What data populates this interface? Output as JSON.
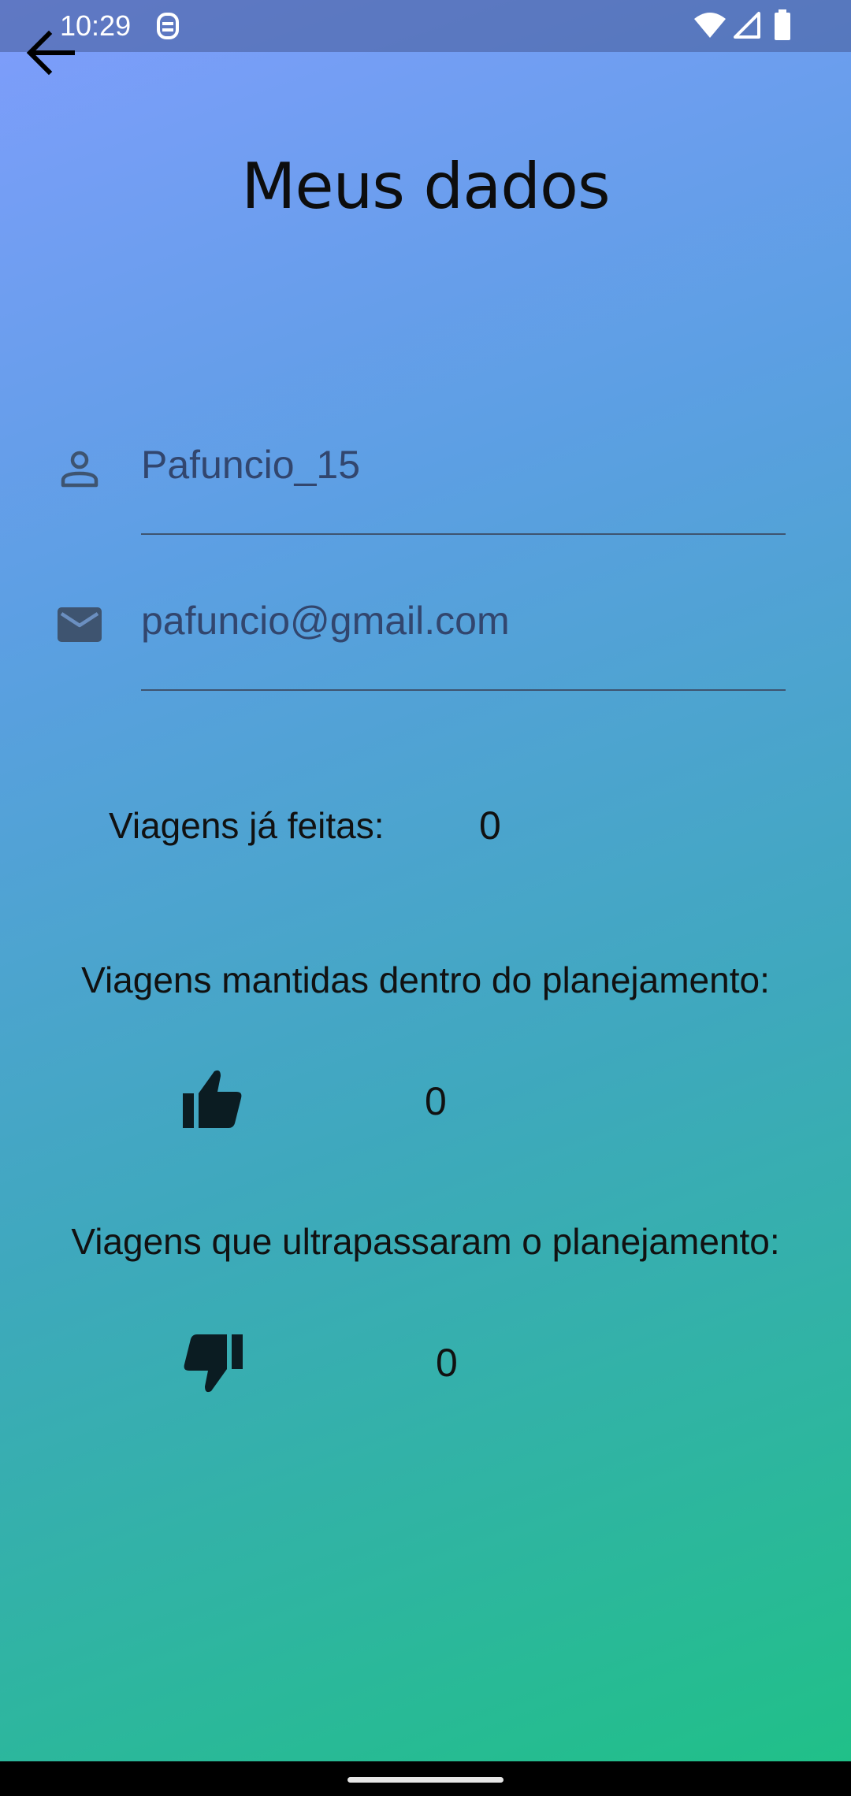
{
  "status_bar": {
    "time": "10:29"
  },
  "header": {
    "title": "Meus dados"
  },
  "profile": {
    "username": "Pafuncio_15",
    "email": "pafuncio@gmail.com"
  },
  "stats": {
    "trips_done_label": "Viagens já feitas:",
    "trips_done_value": "0",
    "within_plan_label": "Viagens mantidas dentro do planejamento:",
    "within_plan_value": "0",
    "over_plan_label": "Viagens que ultrapassaram o planejamento:",
    "over_plan_value": "0"
  },
  "icons": {
    "back": "arrow-back-icon",
    "user": "person-icon",
    "email": "mail-icon",
    "thumb_up": "thumb-up-icon",
    "thumb_down": "thumb-down-icon"
  },
  "colors": {
    "gradient_start": "#7f9dfc",
    "gradient_end": "#1fc186",
    "field_text": "#32466e",
    "field_icon": "#3e5470"
  }
}
